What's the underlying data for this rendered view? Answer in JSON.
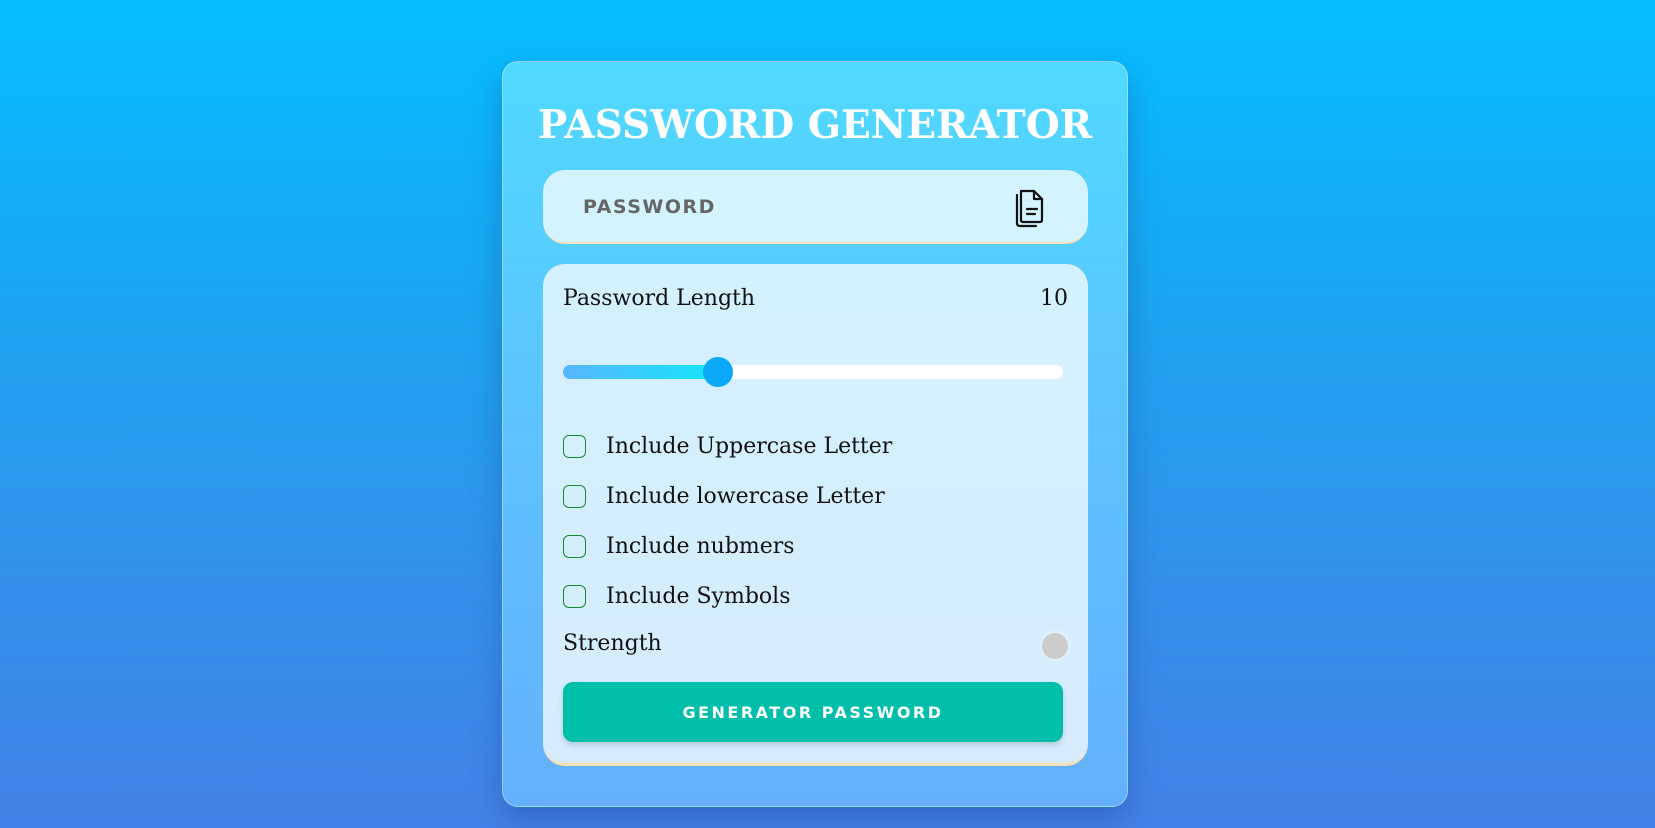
{
  "app": {
    "title": "PASSWORD GENERATOR"
  },
  "display": {
    "placeholder": "PASSWORD",
    "value": "",
    "copy_icon": "copy-document-icon"
  },
  "length": {
    "label": "Password Length",
    "value": "10",
    "min": 1,
    "max": 30,
    "current": 10
  },
  "options": [
    {
      "label": "Include Uppercase Letter",
      "checked": false
    },
    {
      "label": "Include lowercase Letter",
      "checked": false
    },
    {
      "label": "Include nubmers",
      "checked": false
    },
    {
      "label": "Include Symbols",
      "checked": false
    }
  ],
  "strength": {
    "label": "Strength",
    "indicator_color": "#cccccc"
  },
  "generate_button": {
    "label": "GENERATOR PASSWORD",
    "color": "#00bfaa"
  },
  "colors": {
    "accent": "#0aa8f7",
    "checkbox_border": "#1a8a2a"
  }
}
